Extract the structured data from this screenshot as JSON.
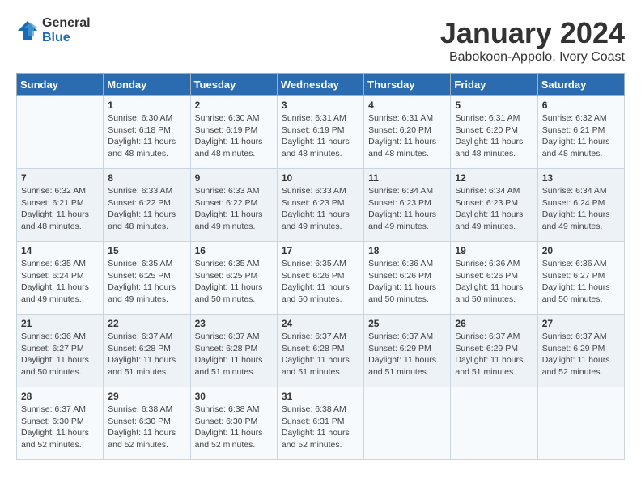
{
  "logo": {
    "general": "General",
    "blue": "Blue"
  },
  "title": "January 2024",
  "subtitle": "Babokoon-Appolo, Ivory Coast",
  "header_days": [
    "Sunday",
    "Monday",
    "Tuesday",
    "Wednesday",
    "Thursday",
    "Friday",
    "Saturday"
  ],
  "weeks": [
    [
      {
        "day": "",
        "info": ""
      },
      {
        "day": "1",
        "info": "Sunrise: 6:30 AM\nSunset: 6:18 PM\nDaylight: 11 hours\nand 48 minutes."
      },
      {
        "day": "2",
        "info": "Sunrise: 6:30 AM\nSunset: 6:19 PM\nDaylight: 11 hours\nand 48 minutes."
      },
      {
        "day": "3",
        "info": "Sunrise: 6:31 AM\nSunset: 6:19 PM\nDaylight: 11 hours\nand 48 minutes."
      },
      {
        "day": "4",
        "info": "Sunrise: 6:31 AM\nSunset: 6:20 PM\nDaylight: 11 hours\nand 48 minutes."
      },
      {
        "day": "5",
        "info": "Sunrise: 6:31 AM\nSunset: 6:20 PM\nDaylight: 11 hours\nand 48 minutes."
      },
      {
        "day": "6",
        "info": "Sunrise: 6:32 AM\nSunset: 6:21 PM\nDaylight: 11 hours\nand 48 minutes."
      }
    ],
    [
      {
        "day": "7",
        "info": "Sunrise: 6:32 AM\nSunset: 6:21 PM\nDaylight: 11 hours\nand 48 minutes."
      },
      {
        "day": "8",
        "info": "Sunrise: 6:33 AM\nSunset: 6:22 PM\nDaylight: 11 hours\nand 48 minutes."
      },
      {
        "day": "9",
        "info": "Sunrise: 6:33 AM\nSunset: 6:22 PM\nDaylight: 11 hours\nand 49 minutes."
      },
      {
        "day": "10",
        "info": "Sunrise: 6:33 AM\nSunset: 6:23 PM\nDaylight: 11 hours\nand 49 minutes."
      },
      {
        "day": "11",
        "info": "Sunrise: 6:34 AM\nSunset: 6:23 PM\nDaylight: 11 hours\nand 49 minutes."
      },
      {
        "day": "12",
        "info": "Sunrise: 6:34 AM\nSunset: 6:23 PM\nDaylight: 11 hours\nand 49 minutes."
      },
      {
        "day": "13",
        "info": "Sunrise: 6:34 AM\nSunset: 6:24 PM\nDaylight: 11 hours\nand 49 minutes."
      }
    ],
    [
      {
        "day": "14",
        "info": "Sunrise: 6:35 AM\nSunset: 6:24 PM\nDaylight: 11 hours\nand 49 minutes."
      },
      {
        "day": "15",
        "info": "Sunrise: 6:35 AM\nSunset: 6:25 PM\nDaylight: 11 hours\nand 49 minutes."
      },
      {
        "day": "16",
        "info": "Sunrise: 6:35 AM\nSunset: 6:25 PM\nDaylight: 11 hours\nand 50 minutes."
      },
      {
        "day": "17",
        "info": "Sunrise: 6:35 AM\nSunset: 6:26 PM\nDaylight: 11 hours\nand 50 minutes."
      },
      {
        "day": "18",
        "info": "Sunrise: 6:36 AM\nSunset: 6:26 PM\nDaylight: 11 hours\nand 50 minutes."
      },
      {
        "day": "19",
        "info": "Sunrise: 6:36 AM\nSunset: 6:26 PM\nDaylight: 11 hours\nand 50 minutes."
      },
      {
        "day": "20",
        "info": "Sunrise: 6:36 AM\nSunset: 6:27 PM\nDaylight: 11 hours\nand 50 minutes."
      }
    ],
    [
      {
        "day": "21",
        "info": "Sunrise: 6:36 AM\nSunset: 6:27 PM\nDaylight: 11 hours\nand 50 minutes."
      },
      {
        "day": "22",
        "info": "Sunrise: 6:37 AM\nSunset: 6:28 PM\nDaylight: 11 hours\nand 51 minutes."
      },
      {
        "day": "23",
        "info": "Sunrise: 6:37 AM\nSunset: 6:28 PM\nDaylight: 11 hours\nand 51 minutes."
      },
      {
        "day": "24",
        "info": "Sunrise: 6:37 AM\nSunset: 6:28 PM\nDaylight: 11 hours\nand 51 minutes."
      },
      {
        "day": "25",
        "info": "Sunrise: 6:37 AM\nSunset: 6:29 PM\nDaylight: 11 hours\nand 51 minutes."
      },
      {
        "day": "26",
        "info": "Sunrise: 6:37 AM\nSunset: 6:29 PM\nDaylight: 11 hours\nand 51 minutes."
      },
      {
        "day": "27",
        "info": "Sunrise: 6:37 AM\nSunset: 6:29 PM\nDaylight: 11 hours\nand 52 minutes."
      }
    ],
    [
      {
        "day": "28",
        "info": "Sunrise: 6:37 AM\nSunset: 6:30 PM\nDaylight: 11 hours\nand 52 minutes."
      },
      {
        "day": "29",
        "info": "Sunrise: 6:38 AM\nSunset: 6:30 PM\nDaylight: 11 hours\nand 52 minutes."
      },
      {
        "day": "30",
        "info": "Sunrise: 6:38 AM\nSunset: 6:30 PM\nDaylight: 11 hours\nand 52 minutes."
      },
      {
        "day": "31",
        "info": "Sunrise: 6:38 AM\nSunset: 6:31 PM\nDaylight: 11 hours\nand 52 minutes."
      },
      {
        "day": "",
        "info": ""
      },
      {
        "day": "",
        "info": ""
      },
      {
        "day": "",
        "info": ""
      }
    ]
  ]
}
